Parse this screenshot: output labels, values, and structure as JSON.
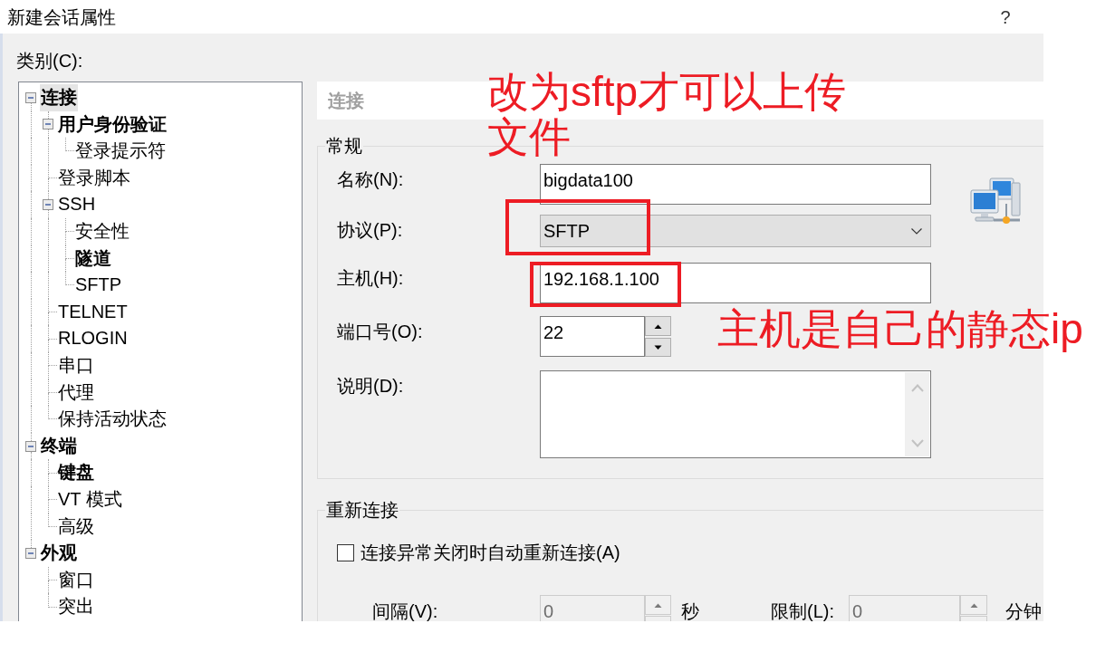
{
  "window": {
    "title": "新建会话属性",
    "help_button": "?"
  },
  "category_label": "类别(C):",
  "tree": [
    {
      "label": "连接",
      "bold": true,
      "selected": true,
      "expanded": true,
      "children": [
        {
          "label": "用户身份验证",
          "bold": true,
          "selected": false,
          "expanded": true,
          "children": [
            {
              "label": "登录提示符",
              "bold": false,
              "selected": false
            }
          ]
        },
        {
          "label": "登录脚本",
          "bold": false,
          "selected": false
        },
        {
          "label": "SSH",
          "bold": false,
          "selected": false,
          "expanded": true,
          "children": [
            {
              "label": "安全性",
              "bold": false,
              "selected": false
            },
            {
              "label": "隧道",
              "bold": true,
              "selected": false
            },
            {
              "label": "SFTP",
              "bold": false,
              "selected": false
            }
          ]
        },
        {
          "label": "TELNET",
          "bold": false,
          "selected": false
        },
        {
          "label": "RLOGIN",
          "bold": false,
          "selected": false
        },
        {
          "label": "串口",
          "bold": false,
          "selected": false
        },
        {
          "label": "代理",
          "bold": false,
          "selected": false
        },
        {
          "label": "保持活动状态",
          "bold": false,
          "selected": false
        }
      ]
    },
    {
      "label": "终端",
      "bold": true,
      "selected": false,
      "expanded": true,
      "children": [
        {
          "label": "键盘",
          "bold": true,
          "selected": false
        },
        {
          "label": "VT 模式",
          "bold": false,
          "selected": false
        },
        {
          "label": "高级",
          "bold": false,
          "selected": false
        }
      ]
    },
    {
      "label": "外观",
      "bold": true,
      "selected": false,
      "expanded": true,
      "children": [
        {
          "label": "窗口",
          "bold": false,
          "selected": false
        },
        {
          "label": "突出",
          "bold": false,
          "selected": false
        }
      ]
    }
  ],
  "panel": {
    "header": "连接",
    "general": {
      "title": "常规",
      "fields": [
        {
          "kind": "text",
          "label": "名称(N):",
          "value": "bigdata100",
          "highlighted": false
        },
        {
          "kind": "dropdown",
          "label": "协议(P):",
          "value": "SFTP",
          "highlighted": true,
          "note": "改为sftp才可以上传文件"
        },
        {
          "kind": "text",
          "label": "主机(H):",
          "value": "192.168.1.100",
          "highlighted": true,
          "note": "主机是自己的静态ip"
        },
        {
          "kind": "spinner",
          "label": "端口号(O):",
          "value": "22",
          "highlighted": false
        },
        {
          "kind": "textarea",
          "label": "说明(D):",
          "highlighted": false
        }
      ]
    },
    "reconnect": {
      "title": "重新连接",
      "checkbox": {
        "label": "连接异常关闭时自动重新连接(A)",
        "checked": false
      },
      "settings": [
        {
          "label": "间隔(V):",
          "value": "0",
          "unit": "秒",
          "disabled": true
        },
        {
          "label": "限制(L):",
          "value": "0",
          "unit": "分钟",
          "disabled": true
        }
      ]
    }
  }
}
